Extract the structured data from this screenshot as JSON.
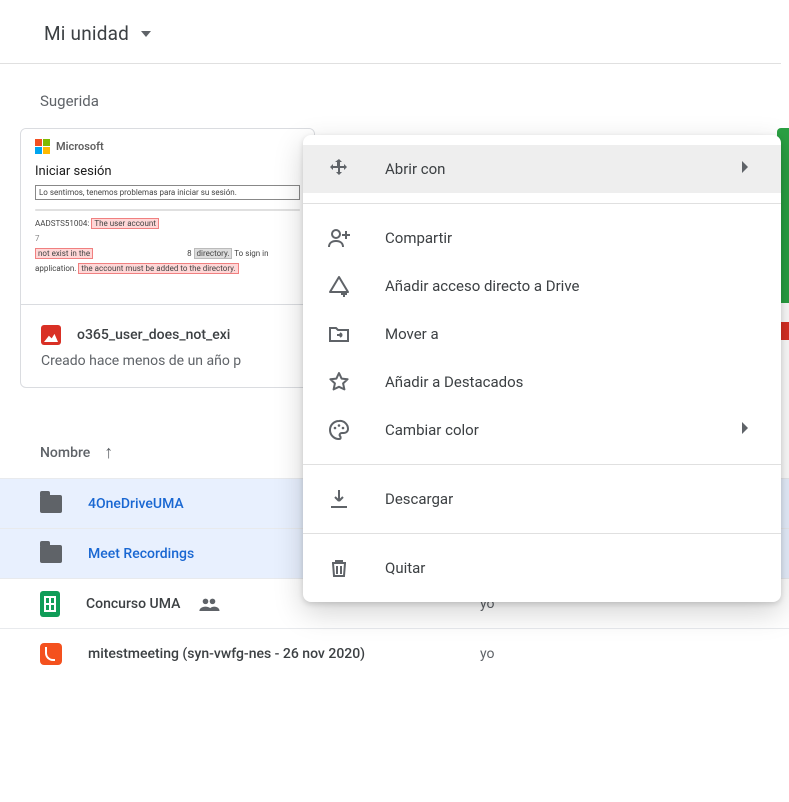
{
  "breadcrumb": {
    "label": "Mi unidad"
  },
  "sections": {
    "suggested": "Sugerida"
  },
  "suggested_card": {
    "thumb": {
      "brand": "Microsoft",
      "title": "Iniciar sesión",
      "msg": "Lo sentimos, tenemos problemas para iniciar su sesión.",
      "code_prefix": "AADSTS51004:",
      "hl1": "The user account",
      "line2_a": "not exist in the",
      "line2_b_num": "8",
      "line2_b_box": "directory.",
      "line2_c": "To sign in",
      "hl3": "the account must be added to the directory."
    },
    "filename": "o365_user_does_not_exi",
    "subtitle": "Creado hace menos de un año p"
  },
  "column_header": {
    "name": "Nombre"
  },
  "rows": [
    {
      "type": "folder",
      "name": "4OneDriveUMA",
      "owner": "",
      "selected": true,
      "shared": false
    },
    {
      "type": "folder",
      "name": "Meet Recordings",
      "owner": "",
      "selected": true,
      "shared": false
    },
    {
      "type": "sheets",
      "name": "Concurso UMA",
      "owner": "yo",
      "selected": false,
      "shared": true
    },
    {
      "type": "jam",
      "name": "mitestmeeting (syn-vwfg-nes - 26 nov 2020)",
      "owner": "yo",
      "selected": false,
      "shared": false
    }
  ],
  "context_menu": {
    "open_with": "Abrir con",
    "share": "Compartir",
    "add_shortcut": "Añadir acceso directo a Drive",
    "move_to": "Mover a",
    "add_starred": "Añadir a Destacados",
    "change_color": "Cambiar color",
    "download": "Descargar",
    "remove": "Quitar"
  }
}
